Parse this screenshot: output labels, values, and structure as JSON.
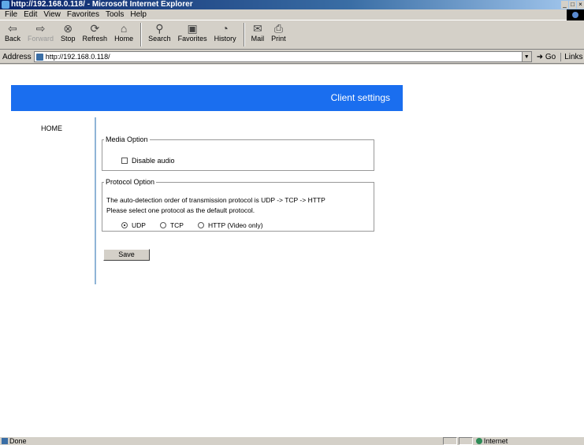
{
  "window": {
    "title": "http://192.168.0.118/ - Microsoft Internet Explorer",
    "controls": [
      "minimize",
      "maximize",
      "close"
    ]
  },
  "menu": [
    "File",
    "Edit",
    "View",
    "Favorites",
    "Tools",
    "Help"
  ],
  "toolbar": {
    "back": "Back",
    "forward": "Forward",
    "stop": "Stop",
    "refresh": "Refresh",
    "home": "Home",
    "search": "Search",
    "favorites": "Favorites",
    "history": "History",
    "mail": "Mail",
    "print": "Print"
  },
  "address": {
    "label": "Address",
    "url": "http://192.168.0.118/",
    "go": "Go",
    "links": "Links"
  },
  "page": {
    "banner_title": "Client settings",
    "banner_color": "#1a6eef",
    "nav_home": "HOME",
    "media_legend": "Media Option",
    "disable_audio_label": "Disable audio",
    "disable_audio_checked": false,
    "protocol_legend": "Protocol Option",
    "protocol_line1": "The auto-detection order of transmission protocol is UDP -> TCP -> HTTP",
    "protocol_line2": "Please select one protocol as the default protocol.",
    "protocols": [
      {
        "label": "UDP",
        "selected": true
      },
      {
        "label": "TCP",
        "selected": false
      },
      {
        "label": "HTTP (Video only)",
        "selected": false
      }
    ],
    "save_label": "Save"
  },
  "status": {
    "text": "Done",
    "zone": "Internet"
  }
}
